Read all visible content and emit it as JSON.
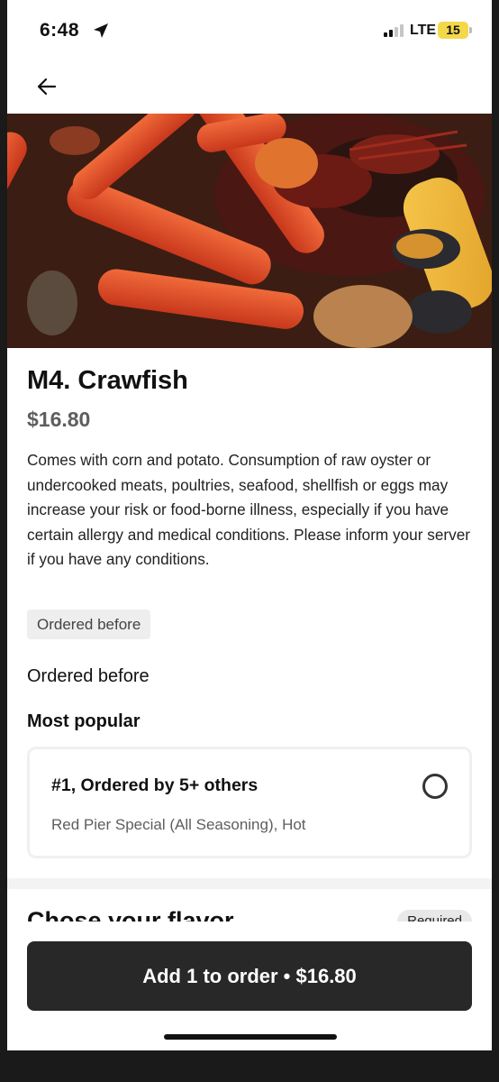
{
  "status_bar": {
    "time": "6:48",
    "network": "LTE",
    "battery": "15"
  },
  "nav": {
    "back_icon": "arrow-left-icon"
  },
  "item": {
    "title": "M4. Crawfish",
    "price": "$16.80",
    "description": "Comes with corn and potato. Consumption of raw oyster or undercooked meats, poultries, seafood, shellfish or eggs may increase your risk or food-borne illness, especially if you have certain allergy and medical conditions. Please inform your server if you have any conditions.",
    "chip": "Ordered before"
  },
  "ordered_before": {
    "label": "Ordered before"
  },
  "most_popular": {
    "label": "Most popular",
    "option_title": "#1, Ordered by 5+ others",
    "option_subtitle": "Red Pier Special (All Seasoning), Hot",
    "selected": false
  },
  "next_section": {
    "title": "Chose your flavor",
    "badge": "Required"
  },
  "footer": {
    "add_button": "Add 1 to order • $16.80"
  },
  "colors": {
    "button_bg": "#282828",
    "battery": "#f3d94a",
    "price": "#5e5e5e"
  }
}
